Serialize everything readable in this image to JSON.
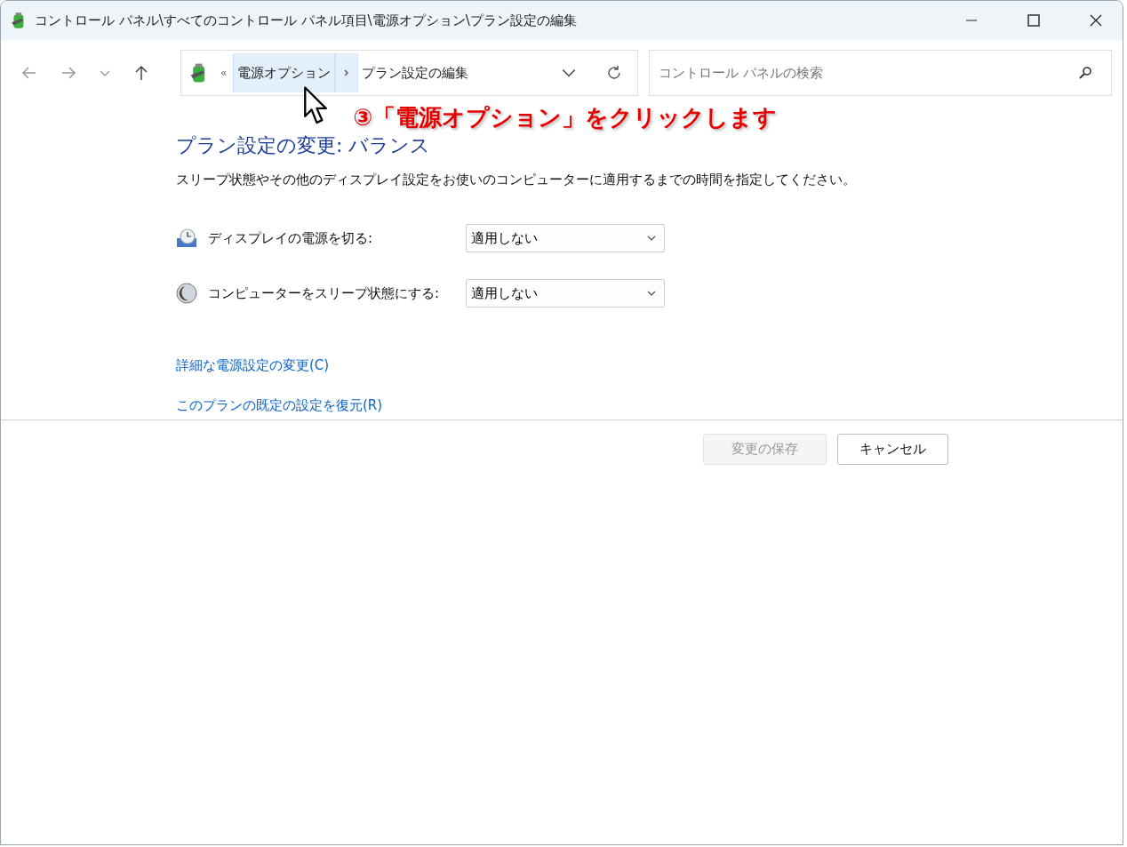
{
  "window": {
    "title": "コントロール パネル\\すべてのコントロール パネル項目\\電源オプション\\プラン設定の編集"
  },
  "address_bar": {
    "overflow": "«",
    "items": [
      {
        "label": "電源オプション",
        "highlighted": true
      },
      {
        "label": "プラン設定の編集",
        "highlighted": false
      }
    ]
  },
  "search": {
    "placeholder": "コントロール パネルの検索"
  },
  "annotation": "③「電源オプション」をクリックします",
  "heading": "プラン設定の変更: バランス",
  "description": "スリープ状態やその他のディスプレイ設定をお使いのコンピューターに適用するまでの時間を指定してください。",
  "settings": [
    {
      "kind": "display",
      "label": "ディスプレイの電源を切る:",
      "value": "適用しない"
    },
    {
      "kind": "sleep",
      "label": "コンピューターをスリープ状態にする:",
      "value": "適用しない"
    }
  ],
  "links": [
    "詳細な電源設定の変更(C)",
    "このプランの既定の設定を復元(R)"
  ],
  "buttons": [
    {
      "label": "変更の保存",
      "disabled": true
    },
    {
      "label": "キャンセル",
      "disabled": false
    }
  ]
}
